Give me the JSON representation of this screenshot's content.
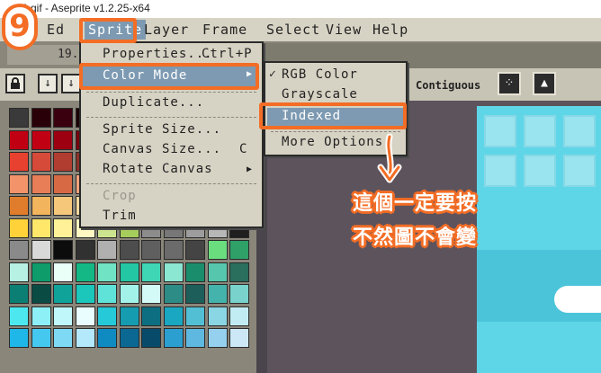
{
  "window": {
    "title": "0.gif - Aseprite v1.2.25-x64"
  },
  "menubar": {
    "items": [
      "Ed",
      "Sprite",
      "Layer",
      "Frame",
      "Select",
      "View",
      "Help"
    ],
    "active": "Sprite"
  },
  "tab": {
    "label": "19."
  },
  "toolbar": {
    "lock_icon": "lock-icon",
    "down_icon": "arrow-down-icon",
    "mode_label": "Contiguous"
  },
  "sprite_menu": {
    "items": [
      {
        "label": "Properties...",
        "shortcut": "Ctrl+P",
        "state": "normal"
      },
      {
        "label": "Color Mode",
        "shortcut": "▶",
        "state": "highlighted"
      },
      {
        "label": "Duplicate...",
        "shortcut": "",
        "state": "normal"
      },
      {
        "label": "Sprite Size...",
        "shortcut": "",
        "state": "normal"
      },
      {
        "label": "Canvas Size...",
        "shortcut": "C",
        "state": "normal"
      },
      {
        "label": "Rotate Canvas",
        "shortcut": "▶",
        "state": "normal"
      },
      {
        "label": "Crop",
        "shortcut": "",
        "state": "disabled"
      },
      {
        "label": "Trim",
        "shortcut": "",
        "state": "normal"
      }
    ]
  },
  "color_mode_menu": {
    "items": [
      {
        "label": "RGB Color",
        "checked": true
      },
      {
        "label": "Grayscale",
        "checked": false
      },
      {
        "label": "Indexed",
        "checked": false
      },
      {
        "label": "More Options",
        "checked": false
      }
    ]
  },
  "annotation": {
    "step": "9",
    "line1": "這個一定要按",
    "line2": "不然圖不會變",
    "color": "#f36d25"
  },
  "palette": {
    "colors": [
      "#3a3a3a",
      "#2a0008",
      "#3b0010",
      "#1a0006",
      "#2a000b",
      "#4a0a12",
      "#1d0404",
      "#2b0b0b",
      "#3d1010",
      "#5b1414",
      "#220606",
      "#c00012",
      "#c10013",
      "#9d0010",
      "#7a000c",
      "#5e0009",
      "#3a0306",
      "#6b1515",
      "#8e1e1e",
      "#a52323",
      "#bf2828",
      "#d62f2f",
      "#e8412f",
      "#d64a3a",
      "#b13d30",
      "#8e3126",
      "#f26b59",
      "#e35b4a",
      "#c64d3e",
      "#a2392d",
      "#7e2c23",
      "#5d2019",
      "#3d1511",
      "#f2936a",
      "#e87e57",
      "#d76a44",
      "#f4a27b",
      "#f7b291",
      "#fac3a8",
      "#ffd4be",
      "#ffe4d4",
      "#e5b59b",
      "#c99b82",
      "#ad826c",
      "#e07d2c",
      "#f2b45c",
      "#f5c77a",
      "#f8d99b",
      "#fbe8bd",
      "#a3a3a3",
      "#c4c4c4",
      "#e0e0e0",
      "#ffffff",
      "#2b2b2b",
      "#151515",
      "#ffd23a",
      "#ffe76a",
      "#fff197",
      "#fff8c2",
      "#cde48f",
      "#a6cc5c",
      "#8c8c8c",
      "#777777",
      "#9d9d9d",
      "#b7b7b7",
      "#1f1f1f",
      "#8a8a8a",
      "#d9d9d9",
      "#0c0c0c",
      "#313131",
      "#b0b0b0",
      "#4d4d4d",
      "#5f5f5f",
      "#6b6b6b",
      "#444444",
      "#6ade7e",
      "#2fa068",
      "#b6f1e3",
      "#0e9c6b",
      "#e9fff8",
      "#13b884",
      "#6fe3c4",
      "#23c7a3",
      "#3fd6b6",
      "#8be6d2",
      "#1a8e6c",
      "#56c7ad",
      "#2a6e5e",
      "#0b7f74",
      "#0a4b44",
      "#10a39a",
      "#1bc6ba",
      "#5fe3d8",
      "#a3f2ea",
      "#d3faf6",
      "#2d8c86",
      "#1d5e5a",
      "#44b3ab",
      "#79d2cc",
      "#4de7f0",
      "#8cf0f6",
      "#bff7fa",
      "#eafdfe",
      "#25c9d8",
      "#159cb0",
      "#0c6e80",
      "#19a7c2",
      "#52bfd4",
      "#8ad6e4",
      "#c2ecf3",
      "#1fb6e8",
      "#45c8f0",
      "#7ed9f5",
      "#b3e9fa",
      "#0f8bc2",
      "#0b6893",
      "#084a69",
      "#2a9fd0",
      "#5fb8e0",
      "#95d1ee",
      "#cce8f7"
    ]
  }
}
